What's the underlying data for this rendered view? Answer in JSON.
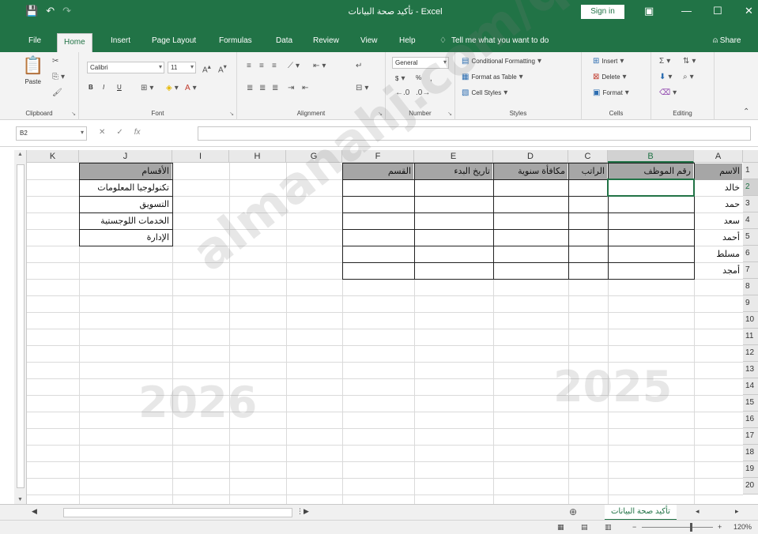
{
  "titlebar": {
    "title": "تأكيد صحة البيانات - Excel",
    "signin": "Sign in",
    "quick_save": "💾",
    "quick_undo": "↶",
    "quick_redo": "↷"
  },
  "tabs": [
    {
      "label": "File"
    },
    {
      "label": "Home"
    },
    {
      "label": "Insert"
    },
    {
      "label": "Page Layout"
    },
    {
      "label": "Formulas"
    },
    {
      "label": "Data"
    },
    {
      "label": "Review"
    },
    {
      "label": "View"
    },
    {
      "label": "Help"
    }
  ],
  "tell_me": "Tell me what you want to do",
  "share": "Share",
  "ribbon": {
    "clipboard": {
      "label": "Clipboard",
      "paste": "Paste"
    },
    "font": {
      "label": "Font",
      "name": "Calibri",
      "size": "11",
      "bold": "B",
      "italic": "I",
      "underline": "U"
    },
    "alignment": {
      "label": "Alignment"
    },
    "number": {
      "label": "Number",
      "format": "General",
      "currency": "$",
      "percent": "%"
    },
    "styles": {
      "label": "Styles",
      "cond": "Conditional Formatting",
      "table": "Format as Table",
      "cell": "Cell Styles"
    },
    "cells": {
      "label": "Cells",
      "insert": "Insert",
      "delete": "Delete",
      "format": "Format"
    },
    "editing": {
      "label": "Editing"
    }
  },
  "formula_bar": {
    "name_box": "B2",
    "fx": "fx",
    "cancel": "✕",
    "enter": "✓",
    "value": ""
  },
  "columns": [
    "A",
    "B",
    "C",
    "D",
    "E",
    "F",
    "G",
    "H",
    "I",
    "J",
    "K"
  ],
  "rows": [
    "1",
    "2",
    "3",
    "4",
    "5",
    "6",
    "7",
    "8",
    "9",
    "10",
    "11",
    "12",
    "13",
    "14",
    "15",
    "16",
    "17",
    "18",
    "19",
    "20"
  ],
  "selected_cell": {
    "column": "B",
    "row": "2"
  },
  "employee_table": {
    "headers": [
      "الاسم",
      "رقم الموظف",
      "الراتب",
      "مكافأة سنوية",
      "تاريخ البدء",
      "القسم"
    ],
    "names": [
      "خالد",
      "حمد",
      "سعد",
      "أحمد",
      "مسلط",
      "أمجد"
    ]
  },
  "departments": {
    "header": "الأقسام",
    "items": [
      "تكنولوجيا المعلومات",
      "التسويق",
      "الخدمات اللوجستية",
      "الإدارة"
    ]
  },
  "sheet_tab": "تأكيد صحة البيانات",
  "add_sheet": "⊕",
  "watermark": {
    "text": "almanahj.com/qa",
    "year_left": "2026",
    "year_right": "2025"
  },
  "status": {
    "zoom": "120%"
  }
}
